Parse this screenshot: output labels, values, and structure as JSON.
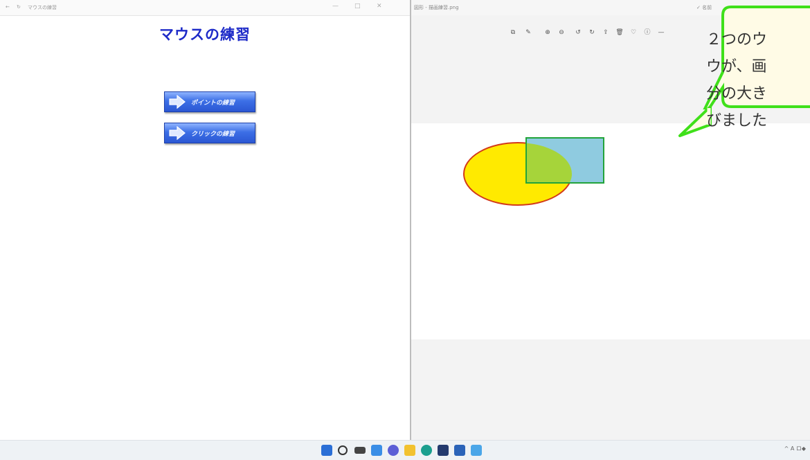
{
  "left_window": {
    "titlebar_text": "マウスの練習",
    "heading": "マウスの練習",
    "buttons": [
      {
        "label": "ポイントの練習"
      },
      {
        "label": "クリックの練習"
      }
    ]
  },
  "right_window": {
    "titlebar_text": "図形 - 描画練習.png",
    "titlebar_right": "✓ 名前",
    "toolbar_icons": [
      "crop-icon",
      "edit-icon",
      "zoom-in-icon",
      "zoom-out-icon",
      "rotate-left-icon",
      "rotate-right-icon",
      "share-icon",
      "delete-icon",
      "favorite-icon",
      "info-icon",
      "more-icon"
    ]
  },
  "callout": {
    "lines": [
      "２つのウ",
      "ウが、画",
      "分の大き",
      "びました"
    ],
    "border_color": "#3fe01a"
  },
  "taskbar": {
    "icons": [
      "start-icon",
      "search-icon",
      "task-view-icon",
      "widgets-icon",
      "chat-icon",
      "explorer-icon",
      "edge-icon",
      "store-icon",
      "photos-icon",
      "app-icon"
    ],
    "tray_text": "^ A ロ◆"
  },
  "colors": {
    "heading": "#1e2bc8",
    "ellipse_fill": "#ffea00",
    "ellipse_stroke": "#d23a1a",
    "rect_fill": "#8fcbe0",
    "rect_stroke": "#22a33a",
    "overlap_fill": "#a6d43a"
  }
}
